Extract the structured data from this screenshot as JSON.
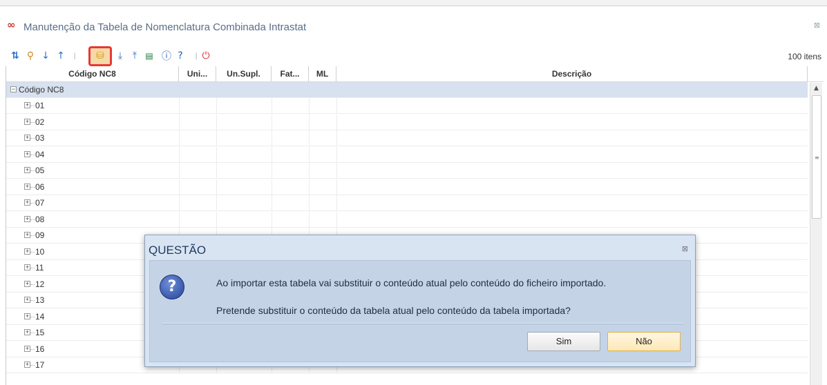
{
  "window": {
    "title": "Manutenção da Tabela de Nomenclatura Combinada Intrastat"
  },
  "toolbar": {
    "item_count": "100 itens"
  },
  "grid": {
    "columns": [
      "Código NC8",
      "Uni...",
      "Un.Supl.",
      "Fat...",
      "ML",
      "Descrição"
    ],
    "root_label": "Código NC8",
    "rows": [
      "01",
      "02",
      "03",
      "04",
      "05",
      "06",
      "07",
      "08",
      "09",
      "10",
      "11",
      "12",
      "13",
      "14",
      "15",
      "16",
      "17"
    ]
  },
  "dialog": {
    "title": "QUESTÃO",
    "message1": "Ao importar esta tabela vai substituir o conteúdo atual pelo conteúdo do ficheiro importado.",
    "message2": "Pretende substituir o conteúdo da tabela atual pelo conteúdo da tabela importada?",
    "yes_label": "Sim",
    "no_label": "Não"
  },
  "colors": {
    "accent": "#2f6fc8",
    "highlight": "#e53935",
    "row_selected": "#d7e1ef"
  }
}
